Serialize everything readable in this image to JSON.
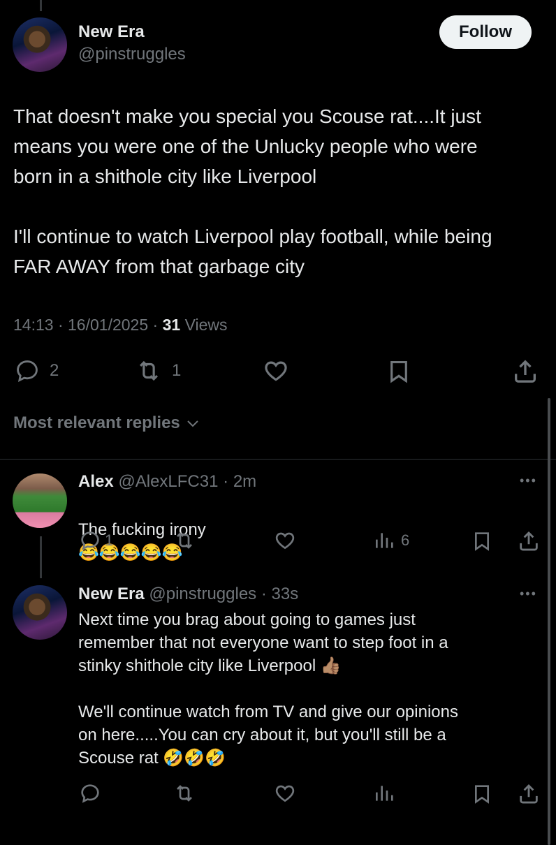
{
  "main_tweet": {
    "name": "New Era",
    "handle": "@pinstruggles",
    "follow_label": "Follow",
    "text": "That doesn't make you special you Scouse rat....It just\nmeans you were one of the Unlucky people who were\nborn in a shithole city like Liverpool\n\nI'll continue to watch Liverpool play football, while being\nFAR AWAY from that garbage city",
    "time": "14:13",
    "date": "16/01/2025",
    "views_count": "31",
    "views_label": "Views",
    "replies": "2",
    "reposts": "1"
  },
  "sort_label": "Most relevant replies",
  "replies": [
    {
      "name": "Alex",
      "handle": "@AlexLFC31",
      "time": "2m",
      "text": "The fucking irony",
      "emojis": "😂😂😂😂😂",
      "reply_count": "1",
      "views": "6"
    },
    {
      "name": "New Era",
      "handle": "@pinstruggles",
      "time": "33s",
      "text1": "Next time you brag about going to games just\nremember that not everyone want to step foot in a\nstinky shithole city like Liverpool",
      "emoji1": "👍🏽",
      "text2": "We'll continue watch from TV and give our opinions\non here.....You can cry about it, but you'll still be a\nScouse rat",
      "emoji2": "🤣🤣🤣"
    }
  ],
  "icons": {
    "reply": "reply-icon",
    "repost": "repost-icon",
    "like": "like-icon",
    "bookmark": "bookmark-icon",
    "share": "share-icon",
    "views": "views-icon",
    "more": "more-icon"
  },
  "colors": {
    "background": "#000000",
    "text": "#e7e9ea",
    "muted": "#71767b",
    "follow_bg": "#eff3f4"
  }
}
